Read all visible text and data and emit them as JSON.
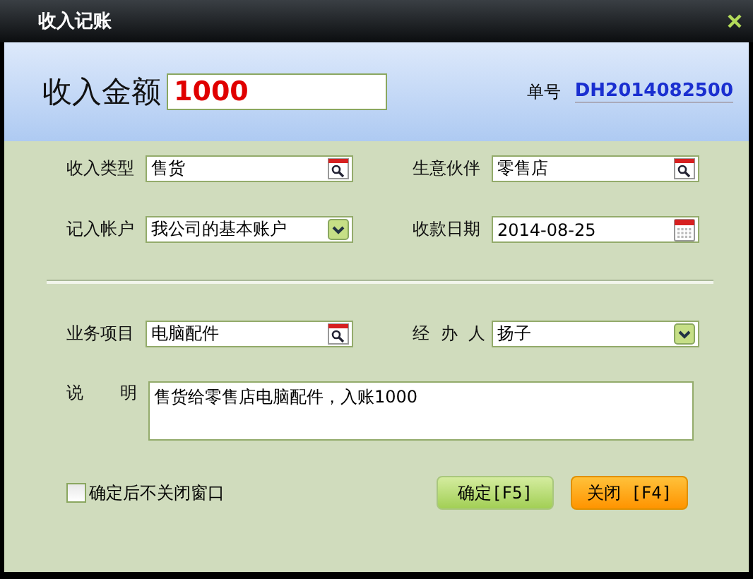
{
  "window": {
    "title": "收入记账"
  },
  "amount": {
    "label": "收入金额",
    "value": "1000"
  },
  "order": {
    "label": "单号",
    "value": "DH2014082500"
  },
  "sections": [
    [
      {
        "label": "收入类型",
        "value": "售货",
        "kind": "lookup"
      },
      {
        "label": "生意伙伴",
        "value": "零售店",
        "kind": "lookup"
      },
      {
        "label": "记入帐户",
        "value": "我公司的基本账户",
        "kind": "dropdown"
      },
      {
        "label": "收款日期",
        "value": "2014-08-25",
        "kind": "date"
      }
    ],
    [
      {
        "label": "业务项目",
        "value": "电脑配件",
        "kind": "lookup"
      },
      {
        "label": "经 办 人",
        "value": "扬子",
        "kind": "dropdown"
      }
    ]
  ],
  "description": {
    "label": "说 明",
    "value": "售货给零售店电脑配件，入账1000"
  },
  "keep_open": {
    "label": "确定后不关闭窗口",
    "checked": false
  },
  "buttons": [
    {
      "label": "确定[F5]",
      "kind": "confirm"
    },
    {
      "label": "关闭 [F4]",
      "kind": "close"
    }
  ]
}
